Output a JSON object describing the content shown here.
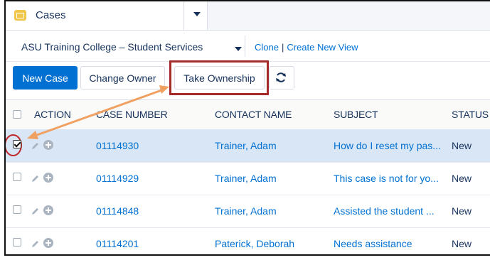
{
  "tab": {
    "label": "Cases"
  },
  "list_view": {
    "name": "ASU Training College – Student Services",
    "clone_label": "Clone",
    "separator": "|",
    "create_view_label": "Create New View"
  },
  "actions": {
    "new_case": "New Case",
    "change_owner": "Change Owner",
    "take_ownership": "Take Ownership",
    "refresh_icon": "refresh-icon"
  },
  "columns": [
    "ACTION",
    "CASE NUMBER",
    "CONTACT NAME",
    "SUBJECT",
    "STATUS"
  ],
  "rows": [
    {
      "checked": true,
      "case_number": "01114930",
      "contact": "Trainer, Adam",
      "subject": "How do I reset my pas...",
      "status": "New"
    },
    {
      "checked": false,
      "case_number": "01114929",
      "contact": "Trainer, Adam",
      "subject": "This case is not for yo...",
      "status": "New"
    },
    {
      "checked": false,
      "case_number": "01114848",
      "contact": "Trainer, Adam",
      "subject": "Assisted the student ...",
      "status": "New"
    },
    {
      "checked": false,
      "case_number": "01114201",
      "contact": "Paterick, Deborah",
      "subject": "Needs assistance",
      "status": "New"
    }
  ],
  "colors": {
    "primary": "#0070d2",
    "highlight_box": "#a52a2a",
    "annotation_arrow": "#f0a060",
    "selected_row": "#d8e6f5"
  }
}
